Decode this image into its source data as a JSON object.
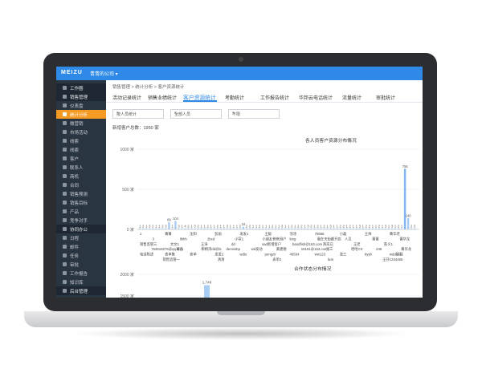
{
  "window": {
    "logo": "MEIZU",
    "company": "青青的公司 ▾"
  },
  "sidebar": {
    "items": [
      {
        "label": "工作圈",
        "kind": "group"
      },
      {
        "label": "销售管理",
        "kind": "group"
      },
      {
        "label": "仪表盘",
        "kind": "item"
      },
      {
        "label": "统计分析",
        "kind": "active"
      },
      {
        "label": "微营销",
        "kind": "item"
      },
      {
        "label": "市场活动",
        "kind": "item"
      },
      {
        "label": "线索",
        "kind": "item"
      },
      {
        "label": "线索",
        "kind": "item"
      },
      {
        "label": "客户",
        "kind": "item"
      },
      {
        "label": "联系人",
        "kind": "item"
      },
      {
        "label": "商机",
        "kind": "item"
      },
      {
        "label": "合同",
        "kind": "item"
      },
      {
        "label": "销售预测",
        "kind": "item"
      },
      {
        "label": "销售目标",
        "kind": "item"
      },
      {
        "label": "产品",
        "kind": "item"
      },
      {
        "label": "竞争对手",
        "kind": "item"
      },
      {
        "label": "协同办公",
        "kind": "group"
      },
      {
        "label": "日程",
        "kind": "item"
      },
      {
        "label": "邮件",
        "kind": "item"
      },
      {
        "label": "任务",
        "kind": "item"
      },
      {
        "label": "审批",
        "kind": "item"
      },
      {
        "label": "工作报告",
        "kind": "item"
      },
      {
        "label": "知识库",
        "kind": "item"
      },
      {
        "label": "后台管理",
        "kind": "group"
      }
    ]
  },
  "breadcrumb": "销售管理 > 统计分析 > 客户资源统计",
  "tabs": [
    {
      "label": "活动记录统计",
      "active": false
    },
    {
      "label": "销售业绩统计",
      "active": false
    },
    {
      "label": "客户资源统计",
      "active": true
    },
    {
      "label": "考勤统计",
      "active": false
    },
    {
      "label": "工作报告统计",
      "active": false
    },
    {
      "label": "华邦云电话统计",
      "active": false
    },
    {
      "label": "流量统计",
      "active": false
    },
    {
      "label": "审批统计",
      "active": false
    }
  ],
  "filters": [
    {
      "value": "按人员统计"
    },
    {
      "value": "全部人员"
    },
    {
      "value": "不限"
    }
  ],
  "summary": {
    "total_text": "新增客户总数：1950 家"
  },
  "chart_data": [
    {
      "type": "bar",
      "title": "各人员客户资源分布情况",
      "ylim": [
        0,
        1000
      ],
      "yticks": [
        "1000 家",
        "500 家",
        "0 家"
      ],
      "yunit": "家",
      "series": [
        {
          "values": [
            1,
            2,
            1,
            3,
            2,
            1,
            1,
            2,
            3,
            89,
            1,
            104,
            3,
            1,
            4,
            2,
            1,
            3,
            2,
            1,
            1,
            2,
            1,
            1,
            2,
            1,
            1,
            3,
            1,
            1,
            1,
            2,
            34,
            2,
            2,
            1,
            1,
            2,
            1,
            1,
            1,
            2,
            1,
            1,
            3,
            1,
            1,
            2,
            1,
            2,
            2,
            1,
            3,
            2,
            1,
            2,
            1,
            2,
            1,
            3,
            1,
            1,
            2,
            2,
            1,
            2,
            1,
            1,
            3,
            1,
            2,
            2,
            1,
            1,
            2,
            1,
            3,
            1,
            3,
            1,
            2,
            1,
            756,
            140,
            2,
            3
          ],
          "labels": [
            "1",
            "2",
            "1",
            "3",
            "2",
            "1",
            "1",
            "2",
            "3",
            "89",
            "1",
            "104",
            "3",
            "1",
            "4",
            "2",
            "1",
            "3",
            "2",
            "1",
            "1",
            "2",
            "1",
            "1",
            "2",
            "1",
            "1",
            "3",
            "1",
            "1",
            "1",
            "2",
            "34",
            "2",
            "2",
            "1",
            "1",
            "2",
            "1",
            "1",
            "1",
            "2",
            "1",
            "1",
            "3",
            "1",
            "1",
            "2",
            "1",
            "2",
            "2",
            "1",
            "3",
            "2",
            "1",
            "2",
            "1",
            "2",
            "1",
            "3",
            "1",
            "1",
            "2",
            "2",
            "1",
            "2",
            "1",
            "1",
            "3",
            "1",
            "2",
            "2",
            "1",
            "1",
            "2",
            "1",
            "3",
            "1",
            "3",
            "1",
            "2",
            "1",
            "756",
            "140",
            "2",
            "3"
          ]
        }
      ],
      "x_labels_row1": [
        "1",
        "菁菁",
        "沈阳",
        "彭丽",
        "发发1",
        "王毅",
        "涂涂",
        "75566",
        "小磊",
        "王帅",
        "菁华老"
      ],
      "x_labels_row2": [
        "3",
        "lihhh",
        "2bcd",
        "小宣1",
        "小朋友爸爸用户",
        "king",
        "我在天街都开店",
        "人员",
        "菁菁",
        "菁华龙"
      ],
      "x_labels_row3": [
        "销售监管三",
        "文文1",
        "王涛",
        "dd",
        "sad新增客户",
        "bandfish@163.com",
        "燕岚已",
        "王老",
        "陈义1"
      ],
      "x_labels_row4": [
        "763518276@qq.com",
        "菁吉",
        "柳梢湾dd@ls",
        "dennisbp",
        "wd发动",
        "黄建德",
        "16181@163.com",
        "张三",
        "哈哈CS",
        "245",
        "菁华龙"
      ],
      "x_labels_row5": [
        "电话陈述",
        "表单集",
        "表单",
        "发发2",
        "wdts",
        "pengzir",
        "40564",
        "ww123",
        "张三",
        "ttyyb",
        "wdd翻翻"
      ],
      "x_labels_row6": [
        "销售监管一",
        "清清",
        "表单2",
        "lixin",
        "王芬1234465"
      ]
    },
    {
      "type": "bar",
      "title": "合作状态分布情况",
      "ylim": [
        0,
        2000
      ],
      "yticks": [
        "2000 家",
        "1500 家"
      ],
      "yunit": "家",
      "series": [
        {
          "values": [
            1749
          ],
          "labels": [
            "1,749"
          ]
        }
      ]
    }
  ],
  "colors": {
    "bar": "#a9cdf2",
    "bar_highlight": "#7fb6ee",
    "accent": "#2e8ae6",
    "sidebar_bg": "#2a3542",
    "active": "#f59a23"
  }
}
